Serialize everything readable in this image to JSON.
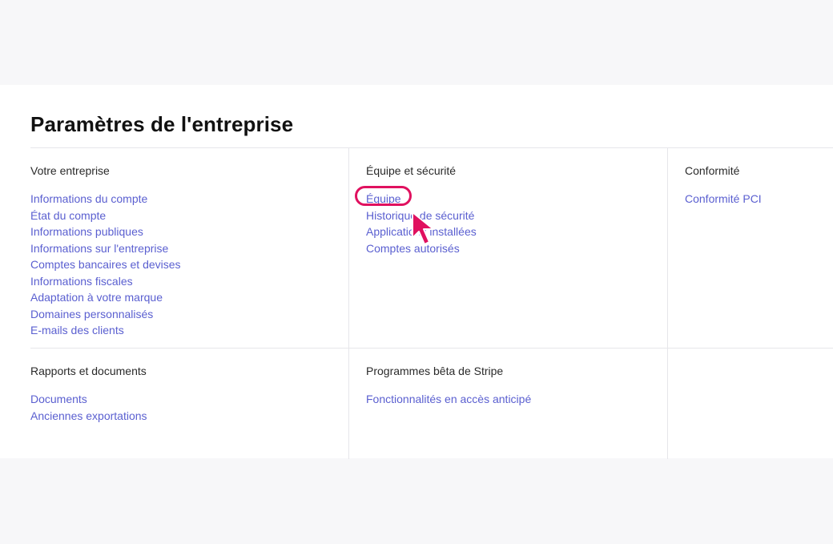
{
  "page": {
    "title": "Paramètres de l'entreprise"
  },
  "sections": {
    "business": {
      "title": "Votre entreprise",
      "links": [
        "Informations du compte",
        "État du compte",
        "Informations publiques",
        "Informations sur l'entreprise",
        "Comptes bancaires et devises",
        "Informations fiscales",
        "Adaptation à votre marque",
        "Domaines personnalisés",
        "E-mails des clients"
      ]
    },
    "team_security": {
      "title": "Équipe et sécurité",
      "links": [
        "Équipe",
        "Historique de sécurité",
        "Applications installées",
        "Comptes autorisés"
      ]
    },
    "compliance": {
      "title": "Conformité",
      "links": [
        "Conformité PCI"
      ]
    },
    "reports": {
      "title": "Rapports et documents",
      "links": [
        "Documents",
        "Anciennes exportations"
      ]
    },
    "beta": {
      "title": "Programmes bêta de Stripe",
      "links": [
        "Fonctionnalités en accès anticipé"
      ]
    }
  },
  "annotation": {
    "highlight_color": "#e0115f",
    "cursor_icon": "arrow-pointer-icon"
  },
  "colors": {
    "link": "#5a5fd0",
    "background": "#f7f7f9",
    "panel": "#ffffff"
  }
}
